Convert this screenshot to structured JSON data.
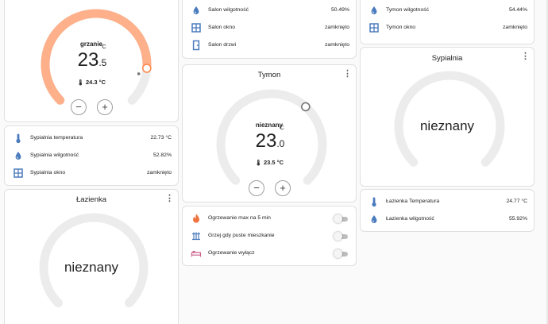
{
  "colors": {
    "heat": "#fdb08a",
    "heat_dot": "#ff8a50",
    "arc_grey": "#ececec",
    "icon_blue": "#4a7bbd",
    "icon_orange": "#ee7440",
    "icon_pink": "#cc5e8a"
  },
  "thermostat_top": {
    "mode": "grzanie",
    "target_int": "23",
    "target_dec": ".5",
    "unit": "°C",
    "current": "24.3 °C",
    "minus": "−",
    "plus": "+",
    "fraction_filled": 0.85
  },
  "sypialnia_sensors": [
    {
      "icon": "thermometer-icon",
      "label": "Sypialnia temperatura",
      "value": "22.73 °C"
    },
    {
      "icon": "water-drop-icon",
      "label": "Sypialnia wilgotność",
      "value": "52.82%"
    },
    {
      "icon": "window-icon",
      "label": "Sypialnia okno",
      "value": "zamknięto"
    }
  ],
  "lazienka_card": {
    "title": "Łazienka",
    "state": "nieznany",
    "menu": "⋮"
  },
  "salon_sensors": [
    {
      "icon": "water-drop-icon",
      "label": "Salon wilgotność",
      "value": "50.49%"
    },
    {
      "icon": "window-icon",
      "label": "Salon okno",
      "value": "zamknięto"
    },
    {
      "icon": "door-icon",
      "label": "Salon drzwi",
      "value": "zamknięto"
    }
  ],
  "tymon_card": {
    "title": "Tymon",
    "menu": "⋮",
    "mode": "nieznany",
    "target_int": "23",
    "target_dec": ".0",
    "unit": "°C",
    "current": "23.5 °C",
    "minus": "−",
    "plus": "+"
  },
  "heating_controls": [
    {
      "icon": "fire-icon",
      "label": "Ogrzewanie max na 5 min",
      "on": false
    },
    {
      "icon": "radiator-icon",
      "label": "Grzej gdy puste mieszkanie",
      "on": false
    },
    {
      "icon": "bed-icon",
      "label": "Ogrzewanie wyłącz",
      "on": false
    }
  ],
  "tymon_sensors": [
    {
      "icon": "water-drop-icon",
      "label": "Tymon wilgotność",
      "value": "54.44%"
    },
    {
      "icon": "window-icon",
      "label": "Tymon okno",
      "value": "zamknięto"
    }
  ],
  "sypialnia_card": {
    "title": "Sypialnia",
    "state": "nieznany",
    "menu": "⋮"
  },
  "lazienka_sensors": [
    {
      "icon": "thermometer-icon",
      "label": "Łazienka Temperatura",
      "value": "24.77 °C"
    },
    {
      "icon": "water-drop-icon",
      "label": "Łazienka wilgotność",
      "value": "55.92%"
    }
  ]
}
